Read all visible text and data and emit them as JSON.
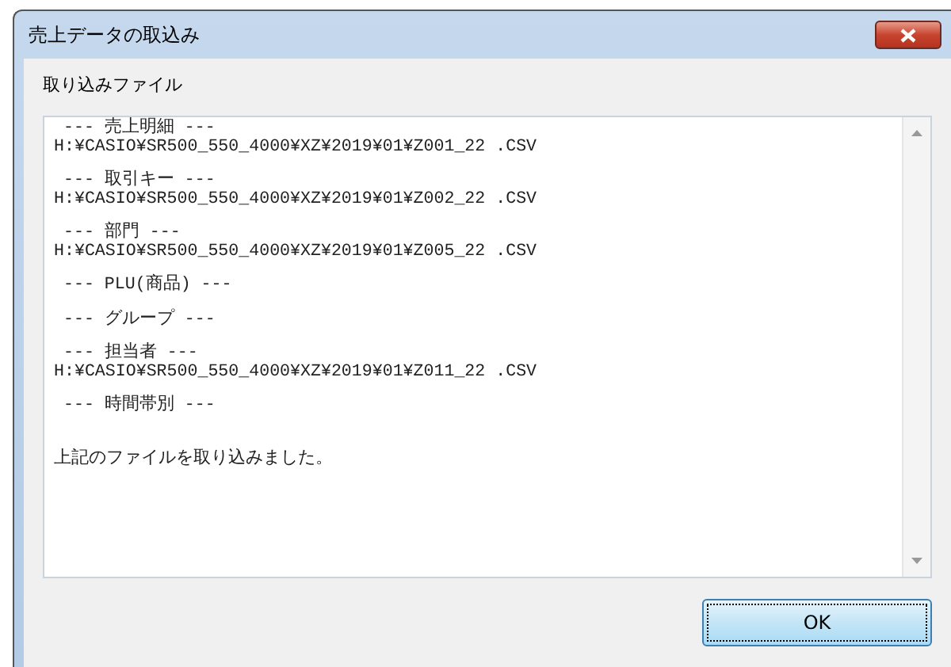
{
  "window": {
    "title": "売上データの取込み"
  },
  "label": "取り込みファイル",
  "sections": [
    {
      "header": "--- 売上明細 ---",
      "path": "H:¥CASIO¥SR500_550_4000¥XZ¥2019¥01¥Z001_22 .CSV"
    },
    {
      "header": "--- 取引キー ---",
      "path": "H:¥CASIO¥SR500_550_4000¥XZ¥2019¥01¥Z002_22 .CSV"
    },
    {
      "header": "--- 部門 ---",
      "path": "H:¥CASIO¥SR500_550_4000¥XZ¥2019¥01¥Z005_22 .CSV"
    },
    {
      "header": "--- PLU(商品) ---"
    },
    {
      "header": "--- グループ ---"
    },
    {
      "header": "--- 担当者 ---",
      "path": "H:¥CASIO¥SR500_550_4000¥XZ¥2019¥01¥Z011_22 .CSV"
    },
    {
      "header": "--- 時間帯別 ---"
    }
  ],
  "message": "上記のファイルを取り込みました。",
  "buttons": [
    {
      "label": "OK"
    }
  ]
}
